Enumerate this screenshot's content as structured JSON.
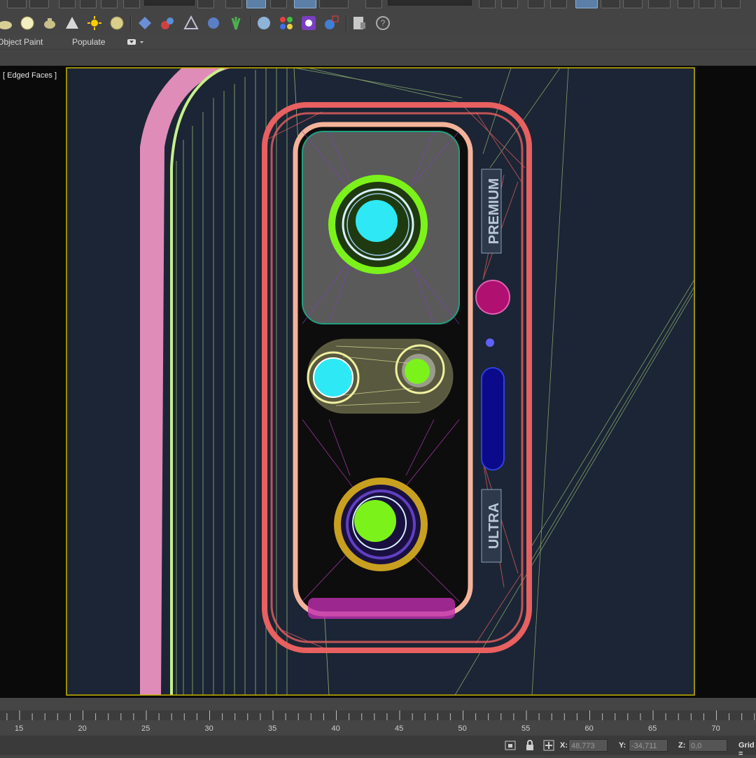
{
  "ribbon": {
    "object_paint": "Object Paint",
    "populate": "Populate"
  },
  "viewport": {
    "label": "[ Edged Faces ]",
    "badge_top": "PREMIUM",
    "badge_bottom": "ULTRA"
  },
  "timeline": {
    "ticks": [
      "15",
      "20",
      "25",
      "30",
      "35",
      "40",
      "45",
      "50",
      "55",
      "60",
      "65",
      "70"
    ]
  },
  "status": {
    "x_label": "X:",
    "x_value": "48,773",
    "y_label": "Y:",
    "y_value": "-34,711",
    "z_label": "Z:",
    "z_value": "0,0",
    "grid_label": "Grid ="
  },
  "colors": {
    "viewport_bg": "#1b2535",
    "frame": "#c8b400",
    "housing": "#e86060",
    "inner_trim": "#f3b39a",
    "pink": "#e08cb8",
    "light_green": "#c7f08a",
    "lens_cyan": "#2ee8f5",
    "lens_green": "#7cf21b"
  }
}
